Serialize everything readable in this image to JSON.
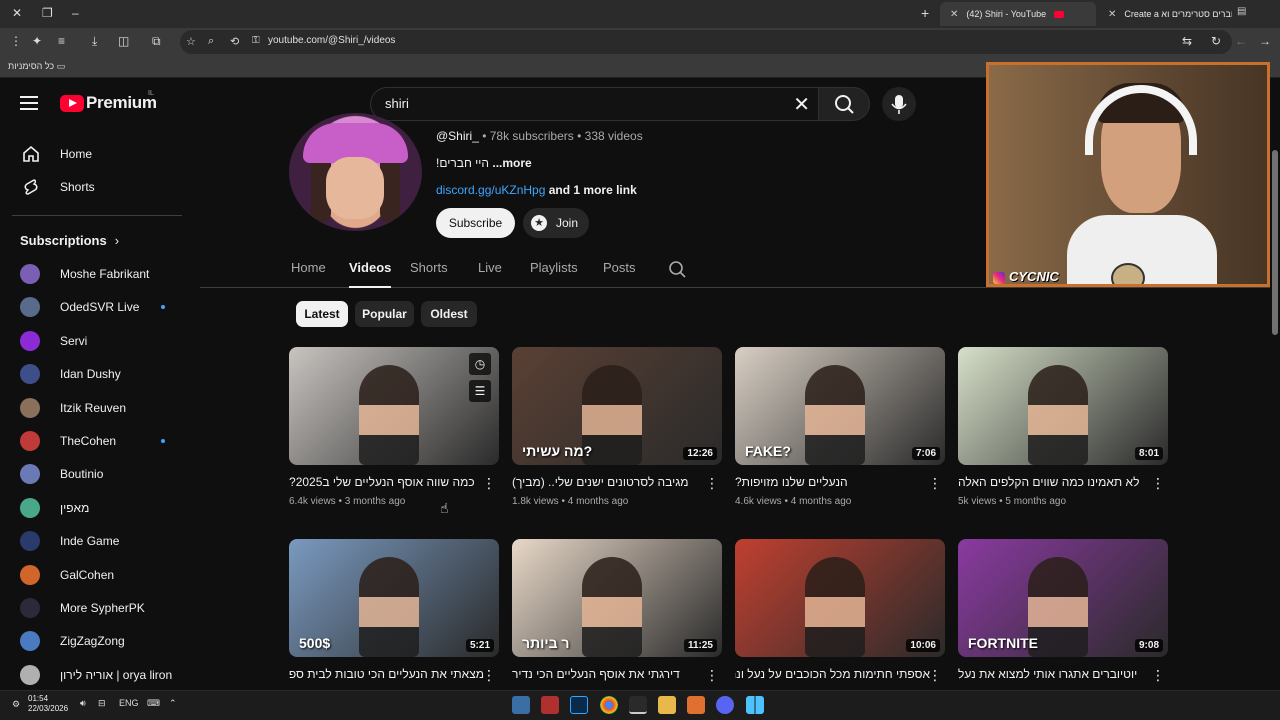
{
  "browser": {
    "tabs": [
      {
        "label": "(42) Shiri - YouTube",
        "active": true
      },
      {
        "label": "Create a יוטיוברים סטרימרים וא",
        "active": false
      }
    ],
    "url": "youtube.com/@Shiri_/videos",
    "bookmarks_label": "כל הסימניות"
  },
  "masthead": {
    "logo_text": "Premium",
    "country_code": "IL",
    "search_value": "shiri"
  },
  "sidebar": {
    "nav": [
      {
        "label": "Home",
        "icon": "home-icon"
      },
      {
        "label": "Shorts",
        "icon": "shorts-icon"
      }
    ],
    "subscriptions_title": "Subscriptions",
    "subscriptions": [
      {
        "name": "Moshe Fabrikant",
        "color": "#7a5fb5",
        "live": false
      },
      {
        "name": "OdedSVR Live",
        "color": "#5a6a8a",
        "live": true
      },
      {
        "name": "Servi",
        "color": "#8b2bd6",
        "live": false
      },
      {
        "name": "Idan Dushy",
        "color": "#3d4e8a",
        "live": false
      },
      {
        "name": "Itzik Reuven",
        "color": "#8a6f5a",
        "live": false
      },
      {
        "name": "TheCohen",
        "color": "#c03a3a",
        "live": true
      },
      {
        "name": "Boutinio",
        "color": "#6a7ab5",
        "live": false
      },
      {
        "name": "מאפין",
        "color": "#4aa88a",
        "live": false
      },
      {
        "name": "Inde Game",
        "color": "#2a3a6a",
        "live": false
      },
      {
        "name": "GalCohen",
        "color": "#d0662a",
        "live": false
      },
      {
        "name": "More SypherPK",
        "color": "#2a2a3a",
        "live": false
      },
      {
        "name": "ZigZagZong",
        "color": "#4a7ac0",
        "live": false
      },
      {
        "name": "אוריה לירון | orya liron",
        "color": "#b0b0b0",
        "live": false
      }
    ]
  },
  "channel": {
    "handle": "@Shiri_",
    "stats": " • 78k subscribers • 338 videos",
    "description": "!היי חברים",
    "more": "...more",
    "link": "discord.gg/uKZnHpg",
    "more_links": " and 1 more link",
    "subscribe": "Subscribe",
    "join": "Join",
    "tabs": [
      "Home",
      "Videos",
      "Shorts",
      "Live",
      "Playlists",
      "Posts"
    ],
    "chips": [
      "Latest",
      "Popular",
      "Oldest"
    ]
  },
  "videos": [
    {
      "title": "כמה שווה אוסף הנעליים שלי ב2025?",
      "views": "6.4k views",
      "age": "3 months ago",
      "duration": "",
      "bg": "#c8c4c0",
      "overlay": ""
    },
    {
      "title": "מגיבה לסרטונים ישנים שלי.. (מביך)",
      "views": "1.8k views",
      "age": "4 months ago",
      "duration": "12:26",
      "bg": "#5a4034",
      "overlay": "מה עשיתי?"
    },
    {
      "title": "הנעליים שלנו מזויפות?",
      "views": "4.6k views",
      "age": "4 months ago",
      "duration": "7:06",
      "bg": "#d8cfc4",
      "overlay": "FAKE?"
    },
    {
      "title": "לא תאמינו כמה שווים הקלפים האלה",
      "views": "5k views",
      "age": "5 months ago",
      "duration": "8:01",
      "bg": "#d6e0c8",
      "overlay": ""
    },
    {
      "title": "מצאתי את הנעליים הכי טובות לבית ספר",
      "views": "",
      "age": "",
      "duration": "5:21",
      "bg": "#7a9ac0",
      "overlay": "500$"
    },
    {
      "title": "דירגתי את אוסף הנעליים הכי נדיר",
      "views": "",
      "age": "",
      "duration": "11:25",
      "bg": "#e8d8c8",
      "overlay": "ר ביותר"
    },
    {
      "title": "אספתי חתימות מכל הכוכבים על נעל ונתתי",
      "views": "",
      "age": "",
      "duration": "10:06",
      "bg": "#c04030",
      "overlay": ""
    },
    {
      "title": "יוטיוברים אתגרו אותי למצוא את נעל",
      "views": "",
      "age": "",
      "duration": "9:08",
      "bg": "#8a3aa0",
      "overlay": "FORTNITE"
    }
  ],
  "cam": {
    "label": "CYCNIC"
  },
  "taskbar": {
    "time": "01:54",
    "date": "22/03/2026",
    "lang": "ENG"
  }
}
